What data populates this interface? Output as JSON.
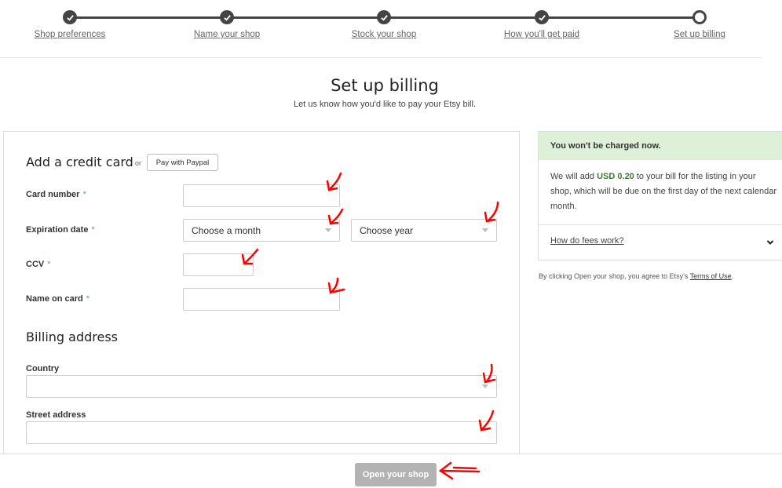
{
  "progress": {
    "steps": [
      {
        "label": "Shop preferences",
        "state": "done"
      },
      {
        "label": "Name your shop",
        "state": "done"
      },
      {
        "label": "Stock your shop",
        "state": "done"
      },
      {
        "label": "How you'll get paid",
        "state": "done"
      },
      {
        "label": "Set up billing",
        "state": "current"
      }
    ]
  },
  "header": {
    "title": "Set up billing",
    "subtitle": "Let us know how you'd like to pay your Etsy bill."
  },
  "form": {
    "credit_card_title": "Add a credit card",
    "or": "or",
    "paypal_label": "Pay with Paypal",
    "card_number_label": "Card number",
    "expiration_label": "Expiration date",
    "month_value": "Choose a month",
    "year_value": "Choose year",
    "ccv_label": "CCV",
    "name_on_card_label": "Name on card",
    "required_mark": "*",
    "billing_title": "Billing address",
    "country_label": "Country",
    "street_label": "Street address"
  },
  "sidebar": {
    "notice": "You won't be charged now.",
    "body_pre": "We will add ",
    "amount": "USD 0.20",
    "body_post": " to your bill for the listing in your shop, which will be due on the first day of the next calendar month.",
    "faq_label": "How do fees work?",
    "terms_pre": "By clicking Open your shop, you agree to Etsy's ",
    "terms_link": "Terms of Use",
    "terms_post": "."
  },
  "footer": {
    "open_shop_label": "Open your shop"
  },
  "colors": {
    "accent_green": "#3a7d2c",
    "notice_bg": "#dff0d8",
    "annotation_red": "#ff0000"
  }
}
